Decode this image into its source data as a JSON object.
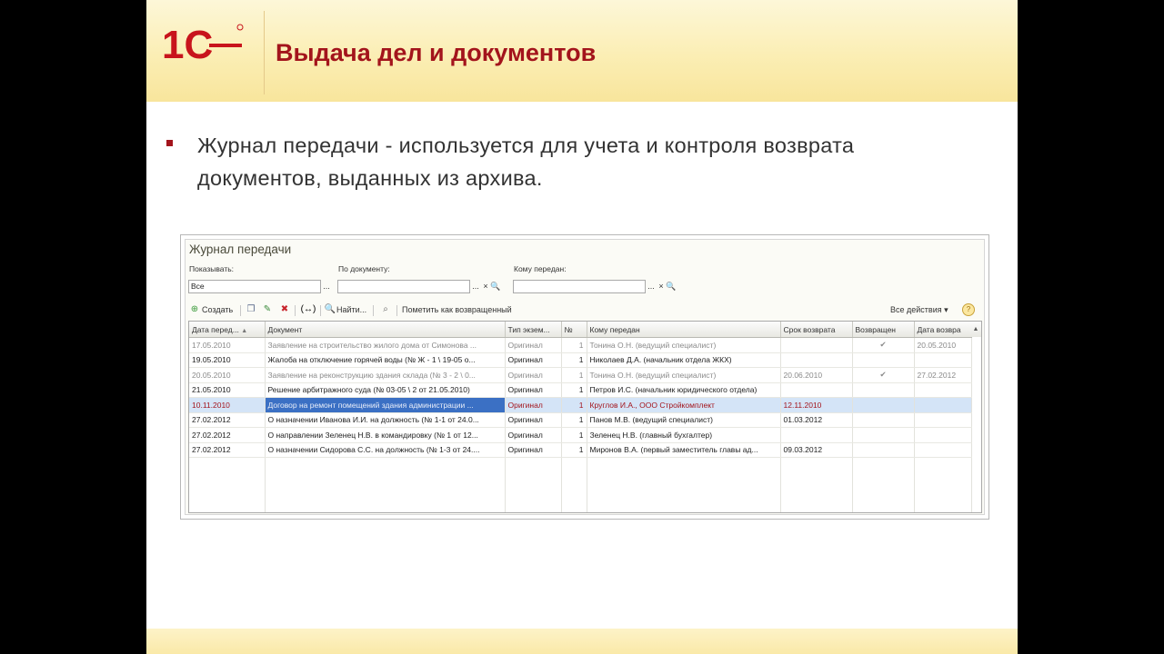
{
  "slide": {
    "logo_text": "1С",
    "title": "Выдача дел и документов",
    "bullet_text": "Журнал передачи - используется для учета и контроля возврата документов, выданных из архива."
  },
  "colors": {
    "accent": "#a3141c",
    "header_bg": "#fbeeb4",
    "selection": "#d4e4f7",
    "focus_cell": "#3b70c4"
  },
  "window": {
    "title": "Журнал передачи",
    "filters": {
      "show": {
        "label": "Показывать:",
        "value": "Все",
        "button": "..."
      },
      "by_document": {
        "label": "По документу:",
        "value": "",
        "button": "...",
        "clear": "×",
        "search": "🔍"
      },
      "transferred_to": {
        "label": "Кому передан:",
        "value": "",
        "button": "...",
        "clear": "×",
        "search": "🔍"
      }
    },
    "toolbar": {
      "create_label": "Создать",
      "find_label": "Найти...",
      "mark_returned_label": "Пометить как возвращенный",
      "all_actions_label": "Все действия ▾",
      "help_label": "?"
    },
    "table": {
      "columns": [
        "Дата перед...",
        "Документ",
        "Тип экзем...",
        "№",
        "Кому передан",
        "Срок возврата",
        "Возвращен",
        "Дата возвра"
      ],
      "rows": [
        {
          "date": "17.05.2010",
          "doc": "Заявление на строительство жилого дома от Симонова ...",
          "type": "Оригинал",
          "num": "1",
          "to": "Тонина О.Н. (ведущий специалист)",
          "due": "",
          "returned": "✔",
          "ret_date": "20.05.2010",
          "state": "returned"
        },
        {
          "date": "19.05.2010",
          "doc": "Жалоба на отключение горячей воды (№ Ж - 1 \\ 19-05 о...",
          "type": "Оригинал",
          "num": "1",
          "to": "Николаев Д.А. (начальник отдела ЖКХ)",
          "due": "",
          "returned": "",
          "ret_date": "",
          "state": ""
        },
        {
          "date": "20.05.2010",
          "doc": "Заявление на реконструкцию здания склада (№ 3 - 2 \\ 0...",
          "type": "Оригинал",
          "num": "1",
          "to": "Тонина О.Н. (ведущий специалист)",
          "due": "20.06.2010",
          "returned": "✔",
          "ret_date": "27.02.2012",
          "state": "returned"
        },
        {
          "date": "21.05.2010",
          "doc": "Решение арбитражного суда (№ 03-05 \\ 2 от 21.05.2010)",
          "type": "Оригинал",
          "num": "1",
          "to": "Петров И.С. (начальник юридического отдела)",
          "due": "",
          "returned": "",
          "ret_date": "",
          "state": ""
        },
        {
          "date": "10.11.2010",
          "doc": "Договор на ремонт помещений здания администрации ...",
          "type": "Оригинал",
          "num": "1",
          "to": "Круглов И.А., ООО Стройкомплект",
          "due": "12.11.2010",
          "returned": "",
          "ret_date": "",
          "state": "selected"
        },
        {
          "date": "27.02.2012",
          "doc": "О назначении Иванова И.И. на должность (№ 1-1 от 24.0...",
          "type": "Оригинал",
          "num": "1",
          "to": "Панов М.В. (ведущий специалист)",
          "due": "01.03.2012",
          "returned": "",
          "ret_date": "",
          "state": ""
        },
        {
          "date": "27.02.2012",
          "doc": "О направлении Зеленец Н.В. в командировку (№ 1 от 12...",
          "type": "Оригинал",
          "num": "1",
          "to": "Зеленец Н.В. (главный бухгалтер)",
          "due": "",
          "returned": "",
          "ret_date": "",
          "state": ""
        },
        {
          "date": "27.02.2012",
          "doc": "О назначении Сидорова С.С. на должность (№ 1-3 от 24....",
          "type": "Оригинал",
          "num": "1",
          "to": "Миронов В.А. (первый заместитель главы ад...",
          "due": "09.03.2012",
          "returned": "",
          "ret_date": "",
          "state": ""
        }
      ]
    }
  }
}
